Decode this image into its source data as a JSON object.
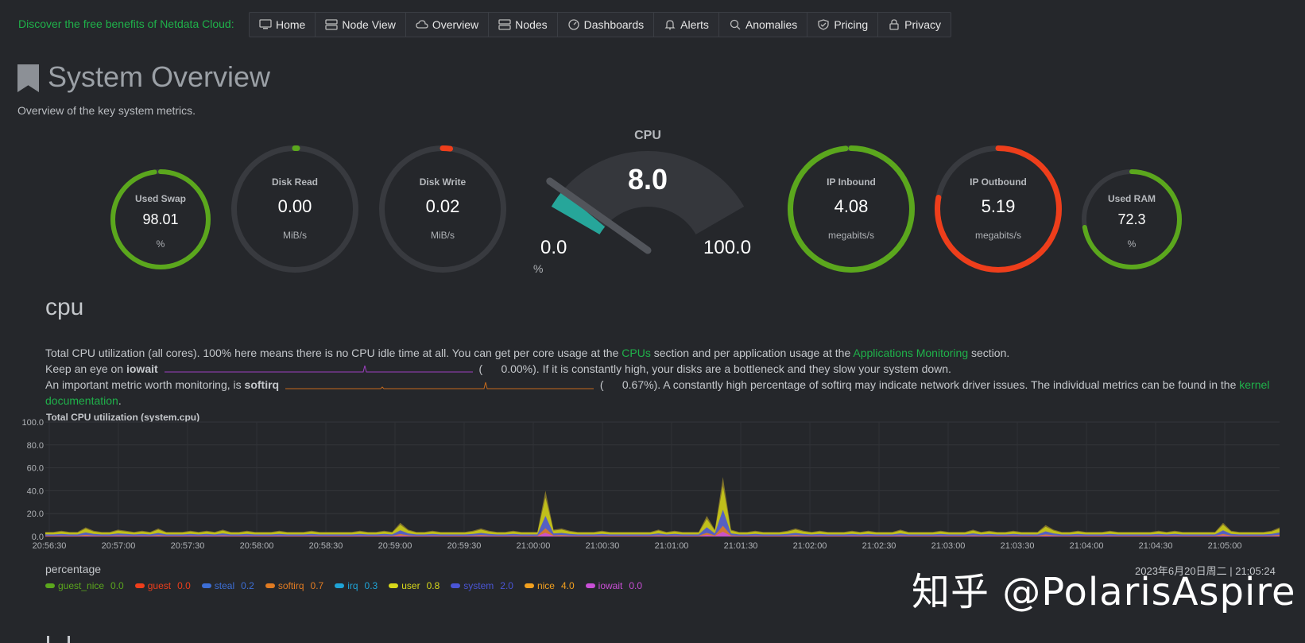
{
  "promo": "Discover the free benefits of Netdata Cloud:",
  "nav": [
    {
      "label": "Home",
      "icon": "monitor-icon"
    },
    {
      "label": "Node View",
      "icon": "server-icon"
    },
    {
      "label": "Overview",
      "icon": "cloud-icon"
    },
    {
      "label": "Nodes",
      "icon": "server-icon"
    },
    {
      "label": "Dashboards",
      "icon": "dashboard-icon"
    },
    {
      "label": "Alerts",
      "icon": "bell-icon"
    },
    {
      "label": "Anomalies",
      "icon": "search-icon"
    },
    {
      "label": "Pricing",
      "icon": "shield-icon"
    },
    {
      "label": "Privacy",
      "icon": "lock-icon"
    }
  ],
  "page": {
    "title": "System Overview",
    "subtitle": "Overview of the key system metrics."
  },
  "gauges": {
    "swap": {
      "label": "Used Swap",
      "value": "98.01",
      "unit": "%",
      "fraction": 0.98,
      "color": "#5ba71d"
    },
    "disk_read": {
      "label": "Disk Read",
      "value": "0.00",
      "unit": "MiB/s",
      "fraction": 0.0,
      "color": "#5ba71d"
    },
    "disk_write": {
      "label": "Disk Write",
      "value": "0.02",
      "unit": "MiB/s",
      "fraction": 0.02,
      "color": "#ee3e1b"
    },
    "cpu": {
      "label": "CPU",
      "value": "8.0",
      "unit": "%",
      "min": "0.0",
      "max": "100.0",
      "fraction": 0.08,
      "color": "#26a69a"
    },
    "ip_in": {
      "label": "IP Inbound",
      "value": "4.08",
      "unit": "megabits/s",
      "fraction": 0.985,
      "color": "#5ba71d"
    },
    "ip_out": {
      "label": "IP Outbound",
      "value": "5.19",
      "unit": "megabits/s",
      "fraction": 0.78,
      "color": "#ee3e1b"
    },
    "ram": {
      "label": "Used RAM",
      "value": "72.3",
      "unit": "%",
      "fraction": 0.723,
      "color": "#5ba71d"
    }
  },
  "cpu": {
    "heading": "cpu",
    "line1_a": "Total CPU utilization (all cores). 100% here means there is no CPU idle time at all. You can get per core usage at the ",
    "line1_link1": "CPUs",
    "line1_b": " section and per application usage at the ",
    "line1_link2": "Applications Monitoring",
    "line1_c": " section.",
    "line2_a": "Keep an eye on ",
    "line2_bold": "iowait",
    "line2_val": "(      0.00%). If it is constantly high, your disks are a bottleneck and they slow your system down.",
    "line3_a": "An important metric worth monitoring, is ",
    "line3_bold": "softirq",
    "line3_val": "(      0.67%). A constantly high percentage of softirq may indicate network driver issues. The individual metrics can be found in the ",
    "line3_link": "kernel",
    "line4_link": "documentation",
    "line4_end": ".",
    "chart_title": "Total CPU utilization (system.cpu)",
    "percentage": "percentage",
    "timestamp": "2023年6月20日周二 | 21:05:24"
  },
  "watermark": "知乎 @PolarisAspire",
  "chart_data": {
    "type": "area",
    "title": "Total CPU utilization (system.cpu)",
    "ylabel": "percentage",
    "ylim": [
      0,
      100
    ],
    "yticks": [
      "100.0",
      "80.0",
      "60.0",
      "40.0",
      "20.0",
      "0.0"
    ],
    "xticks": [
      "20:56:30",
      "20:57:00",
      "20:57:30",
      "20:58:00",
      "20:58:30",
      "20:59:00",
      "20:59:30",
      "21:00:00",
      "21:00:30",
      "21:01:00",
      "21:01:30",
      "21:02:00",
      "21:02:30",
      "21:03:00",
      "21:03:30",
      "21:04:00",
      "21:04:30",
      "21:05:00"
    ],
    "series": [
      {
        "name": "guest_nice",
        "value": "0.0",
        "color": "#5ba71d"
      },
      {
        "name": "guest",
        "value": "0.0",
        "color": "#ee3e1b"
      },
      {
        "name": "steal",
        "value": "0.2",
        "color": "#3d6fd6"
      },
      {
        "name": "softirq",
        "value": "0.7",
        "color": "#e07b22"
      },
      {
        "name": "irq",
        "value": "0.3",
        "color": "#1fa3d6"
      },
      {
        "name": "user",
        "value": "0.8",
        "color": "#d8d81a"
      },
      {
        "name": "system",
        "value": "2.0",
        "color": "#4a55d6"
      },
      {
        "name": "nice",
        "value": "4.0",
        "color": "#f2a01f"
      },
      {
        "name": "iowait",
        "value": "0.0",
        "color": "#c94fd6"
      }
    ],
    "stack_total": [
      4,
      4,
      5,
      4,
      4,
      8,
      5,
      4,
      4,
      6,
      5,
      4,
      5,
      4,
      7,
      4,
      4,
      4,
      5,
      4,
      5,
      4,
      6,
      4,
      4,
      5,
      4,
      4,
      4,
      5,
      4,
      4,
      4,
      5,
      4,
      4,
      4,
      4,
      4,
      5,
      4,
      4,
      5,
      4,
      12,
      6,
      4,
      4,
      5,
      4,
      4,
      4,
      4,
      5,
      7,
      5,
      4,
      4,
      5,
      4,
      4,
      4,
      40,
      6,
      7,
      5,
      4,
      4,
      4,
      5,
      4,
      4,
      4,
      4,
      4,
      4,
      6,
      4,
      5,
      4,
      4,
      4,
      18,
      6,
      52,
      6,
      4,
      4,
      5,
      4,
      4,
      4,
      5,
      7,
      5,
      4,
      5,
      4,
      4,
      4,
      5,
      4,
      5,
      4,
      4,
      4,
      6,
      4,
      4,
      4,
      4,
      5,
      4,
      4,
      4,
      6,
      4,
      5,
      4,
      4,
      5,
      4,
      4,
      4,
      10,
      6,
      4,
      4,
      5,
      4,
      4,
      4,
      5,
      4,
      4,
      4,
      4,
      4,
      5,
      4,
      5,
      4,
      4,
      4,
      4,
      4,
      12,
      5,
      4,
      4,
      4,
      4,
      5,
      8
    ]
  }
}
